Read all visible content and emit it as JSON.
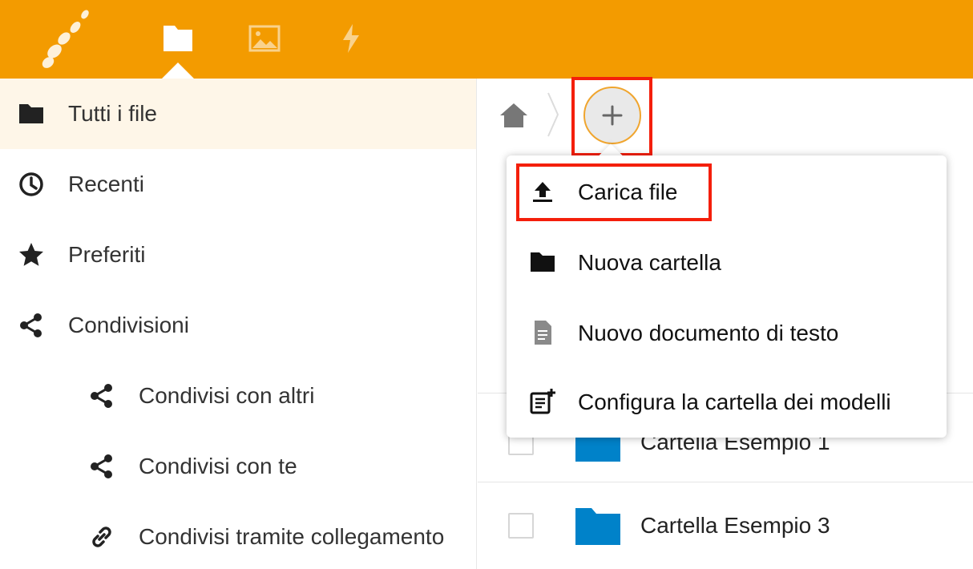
{
  "colors": {
    "header": "#f39b00",
    "active_bg": "#fef6e8",
    "folder": "#0082c9",
    "highlight": "#f41f0b"
  },
  "header": {
    "apps": [
      {
        "name": "files",
        "icon": "folder-icon",
        "active": true
      },
      {
        "name": "photos",
        "icon": "image-icon",
        "active": false
      },
      {
        "name": "activity",
        "icon": "lightning-icon",
        "active": false
      }
    ]
  },
  "sidebar": {
    "items": [
      {
        "label": "Tutti i file",
        "icon": "folder-icon",
        "active": true
      },
      {
        "label": "Recenti",
        "icon": "clock-icon"
      },
      {
        "label": "Preferiti",
        "icon": "star-icon"
      },
      {
        "label": "Condivisioni",
        "icon": "share-icon"
      },
      {
        "label": "Condivisi con altri",
        "icon": "share-icon"
      },
      {
        "label": "Condivisi con te",
        "icon": "share-icon"
      },
      {
        "label": "Condivisi tramite collegamento",
        "icon": "link-icon"
      }
    ]
  },
  "breadcrumb": {
    "home_icon": "home-icon",
    "add_icon": "plus-icon"
  },
  "new_menu": {
    "items": [
      {
        "label": "Carica file",
        "icon": "upload-icon"
      },
      {
        "label": "Nuova cartella",
        "icon": "folder-icon"
      },
      {
        "label": "Nuovo documento di testo",
        "icon": "document-icon"
      },
      {
        "label": "Configura la cartella dei modelli",
        "icon": "template-icon"
      }
    ]
  },
  "files": [
    {
      "name": "Cartella Esempio 1",
      "type": "folder"
    },
    {
      "name": "Cartella Esempio 3",
      "type": "folder"
    }
  ]
}
